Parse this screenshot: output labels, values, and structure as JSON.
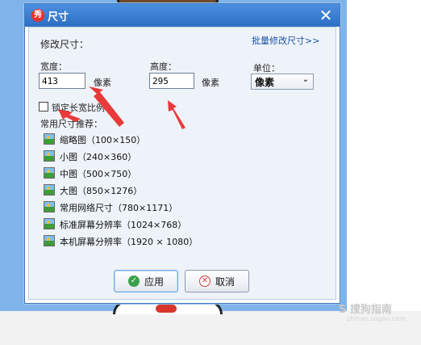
{
  "dialog": {
    "title": "尺寸",
    "app_icon_text": "秀",
    "close_symbol": "✕",
    "section_title": "修改尺寸：",
    "batch_link": "批量修改尺寸>>",
    "width_label": "宽度：",
    "width_value": "413",
    "width_unit": "像素",
    "height_label": "高度：",
    "height_value": "295",
    "height_unit": "像素",
    "unit_label": "单位：",
    "unit_selected": "像素",
    "lock_ratio_label": "锁定长宽比例",
    "lock_ratio_checked": false,
    "presets_title": "常用尺寸推荐：",
    "presets": [
      {
        "label": "缩略图（100×150）"
      },
      {
        "label": "小图（240×360）"
      },
      {
        "label": "中图（500×750）"
      },
      {
        "label": "大图（850×1276）"
      },
      {
        "label": "常用网络尺寸（780×1171）"
      },
      {
        "label": "标准屏幕分辨率（1024×768）"
      },
      {
        "label": "本机屏幕分辨率（1920 × 1080）"
      }
    ],
    "apply_label": "应用",
    "cancel_label": "取消"
  },
  "watermark": {
    "text": "S 搜狗指南",
    "url": "zhinan.sogou.com"
  },
  "colors": {
    "titlebar": "#2d6fc4",
    "backdrop": "#7fb3ea",
    "arrow": "#e83a3a",
    "link": "#1a4fa8"
  },
  "icons": [
    "app-logo-icon",
    "close-icon",
    "image-icon",
    "check-circle-icon",
    "cancel-circle-icon",
    "chevron-down-icon"
  ]
}
